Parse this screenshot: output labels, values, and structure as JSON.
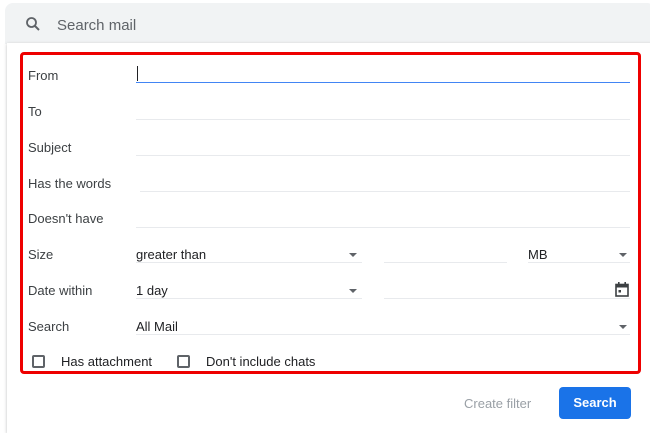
{
  "search": {
    "placeholder": "Search mail"
  },
  "form": {
    "labels": {
      "from": "From",
      "to": "To",
      "subject": "Subject",
      "has_words": "Has the words",
      "doesnt_have": "Doesn't have",
      "size": "Size",
      "date_within": "Date within",
      "search": "Search"
    },
    "size_operator": "greater than",
    "size_unit": "MB",
    "date_within": "1 day",
    "search_in": "All Mail",
    "has_attachment": "Has attachment",
    "dont_include_chats": "Don't include chats"
  },
  "buttons": {
    "create_filter": "Create filter",
    "search": "Search"
  },
  "colors": {
    "accent": "#1a73e8",
    "highlight": "#e00000"
  }
}
